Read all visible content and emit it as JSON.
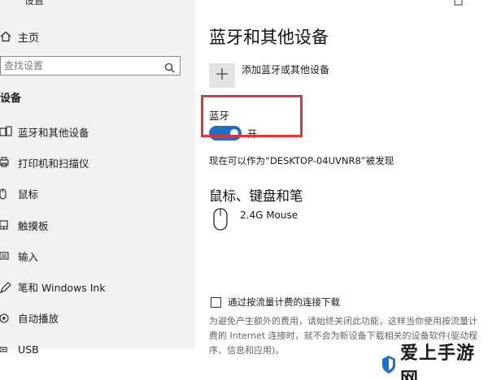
{
  "window": {
    "title": "设置"
  },
  "sidebar": {
    "home_label": "主页",
    "search_placeholder": "查找设置",
    "section_label": "设备",
    "items": [
      {
        "label": "蓝牙和其他设备",
        "icon": "bluetooth-devices-icon"
      },
      {
        "label": "打印机和扫描仪",
        "icon": "printer-icon"
      },
      {
        "label": "鼠标",
        "icon": "mouse-icon"
      },
      {
        "label": "触摸板",
        "icon": "touchpad-icon"
      },
      {
        "label": "输入",
        "icon": "keyboard-icon"
      },
      {
        "label": "笔和 Windows Ink",
        "icon": "pen-icon"
      },
      {
        "label": "自动播放",
        "icon": "autoplay-icon"
      },
      {
        "label": "USB",
        "icon": "usb-icon"
      }
    ]
  },
  "main": {
    "title": "蓝牙和其他设备",
    "add_device_label": "添加蓝牙或其他设备",
    "bluetooth_label": "蓝牙",
    "bluetooth_state": "开",
    "bluetooth_on": true,
    "discoverable_text": "现在可以作为“DESKTOP-04UVNR8”被发现",
    "mice_section_title": "鼠标、键盘和笔",
    "device_name": "2.4G Mouse",
    "metered_checkbox_label": "通过按流量计费的连接下载",
    "metered_checked": false,
    "metered_description": "为避免产生额外的费用，请始终关闭此功能，这样当你使用按流量计费的 Internet 连接时，就不会为新设备下载相关的设备软件(驱动程序、信息和应用)。"
  },
  "watermark": {
    "text": "爱上手游网"
  },
  "colors": {
    "accent": "#1f6fc5",
    "highlight": "#d9373b",
    "sidebar_bg": "#f2f2f2"
  }
}
